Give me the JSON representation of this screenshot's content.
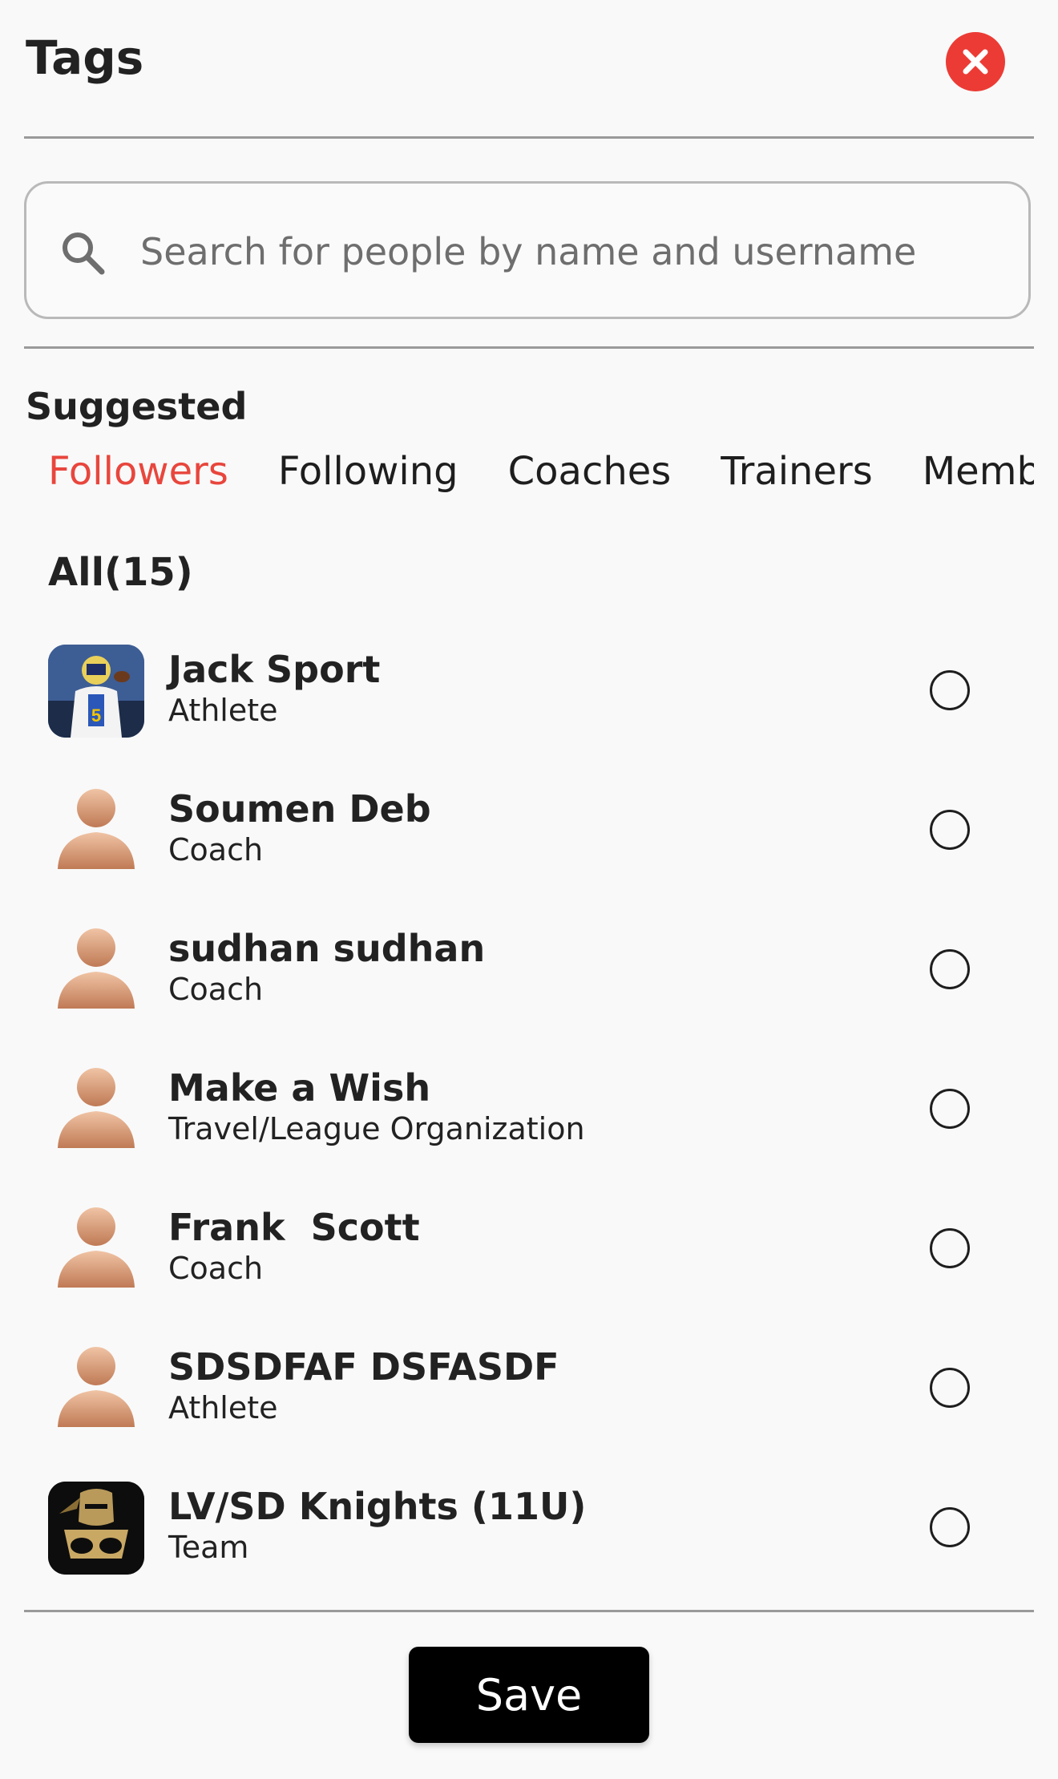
{
  "header": {
    "title": "Tags"
  },
  "search": {
    "placeholder": "Search for people by name and username",
    "value": ""
  },
  "suggested": {
    "heading": "Suggested",
    "tabs": [
      "Followers",
      "Following",
      "Coaches",
      "Trainers",
      "Members"
    ],
    "active_tab": "Followers",
    "count_label": "All(15)"
  },
  "people": [
    {
      "name": "Jack Sport",
      "role": "Athlete",
      "avatar": "athlete-photo"
    },
    {
      "name": "Soumen Deb",
      "role": "Coach",
      "avatar": "default-person"
    },
    {
      "name": "sudhan sudhan",
      "role": "Coach",
      "avatar": "default-person"
    },
    {
      "name": "Make a Wish",
      "role": "Travel/League Organization",
      "avatar": "default-person"
    },
    {
      "name": "Frank  Scott",
      "role": "Coach",
      "avatar": "default-person"
    },
    {
      "name": "SDSDFAF DSFASDF",
      "role": "Athlete",
      "avatar": "default-person"
    },
    {
      "name": "LV/SD Knights (11U)",
      "role": "Team",
      "avatar": "team-logo"
    }
  ],
  "footer": {
    "save_label": "Save"
  },
  "colors": {
    "accent": "#e8463d",
    "close": "#ec3b35",
    "save_bg": "#000000"
  }
}
